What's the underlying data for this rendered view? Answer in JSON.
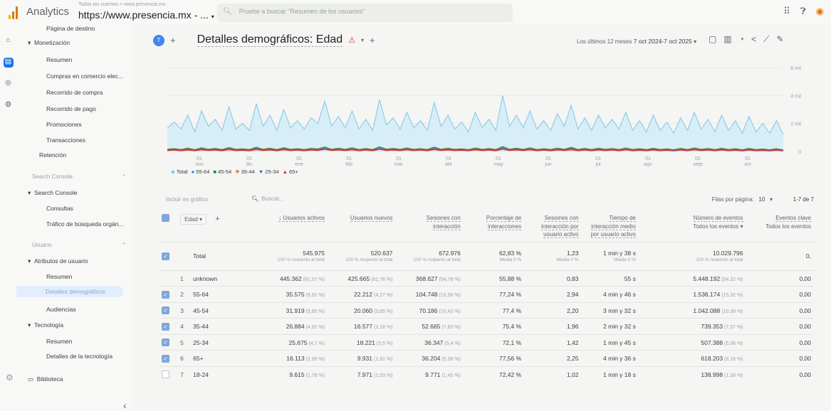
{
  "topbar": {
    "app_name": "Analytics",
    "account_path": "Todas las cuentas > www.presencia.mx",
    "property": "https://www.presencia.mx - ...",
    "search_placeholder": "Pruebe a buscar \"Resumen de los usuarios\""
  },
  "nav": {
    "items": [
      {
        "label": "Página de destino"
      },
      {
        "label": "Monetización"
      },
      {
        "label": "Resumen"
      },
      {
        "label": "Compras en comercio elec..."
      },
      {
        "label": "Recorrido de compra"
      },
      {
        "label": "Recorrido de pago"
      },
      {
        "label": "Promociones"
      },
      {
        "label": "Transacciones"
      },
      {
        "label": "Retención"
      },
      {
        "label": "Search Console"
      },
      {
        "label": "Search Console"
      },
      {
        "label": "Consultas"
      },
      {
        "label": "Tráfico de búsqueda orgán..."
      },
      {
        "label": "Usuario"
      },
      {
        "label": "Atributos de usuario"
      },
      {
        "label": "Resumen"
      },
      {
        "label": "Detalles demográficos"
      },
      {
        "label": "Audiencias"
      },
      {
        "label": "Tecnología"
      },
      {
        "label": "Resumen"
      },
      {
        "label": "Detalles de la tecnología"
      },
      {
        "label": "Biblioteca"
      }
    ]
  },
  "header": {
    "avatar": "T",
    "title": "Detalles demográficos: Edad",
    "date_prefix": "Los últimos 12 meses",
    "date_range": "7 oct 2024-7 oct 2025"
  },
  "chart_data": {
    "type": "line",
    "x_ticks": [
      {
        "day": "01",
        "month": "nov"
      },
      {
        "day": "01",
        "month": "dic"
      },
      {
        "day": "01",
        "month": "ene"
      },
      {
        "day": "01",
        "month": "feb"
      },
      {
        "day": "01",
        "month": "mar"
      },
      {
        "day": "01",
        "month": "abr"
      },
      {
        "day": "01",
        "month": "may"
      },
      {
        "day": "01",
        "month": "jun"
      },
      {
        "day": "01",
        "month": "jul"
      },
      {
        "day": "01",
        "month": "ago"
      },
      {
        "day": "01",
        "month": "sept"
      },
      {
        "day": "01",
        "month": "oct"
      }
    ],
    "y_ticks": [
      "6 mil",
      "4 mil",
      "2 mil",
      "0"
    ],
    "ylim": [
      0,
      6000
    ],
    "series": [
      {
        "name": "Total",
        "color": "#7ec8e3",
        "values": [
          1700,
          2100,
          1600,
          2600,
          1400,
          2900,
          1800,
          2300,
          1500,
          3200,
          1600,
          2000,
          1500,
          3400,
          1800,
          2600,
          1500,
          3000,
          1700,
          2200,
          1600,
          2400,
          2000,
          3600,
          1800,
          2500,
          1700,
          2900,
          1600,
          2300,
          1500,
          3700,
          1900,
          2400,
          1600,
          2800,
          1700,
          2200,
          1500,
          3500,
          1800,
          2600,
          1600,
          2100,
          1400,
          2800,
          1700,
          2300,
          1500,
          4000,
          1800,
          2600,
          1700,
          2900,
          1600,
          2200,
          1500,
          2700,
          1800,
          3300,
          1600,
          2400,
          1500,
          2600,
          1700,
          2300,
          1600,
          2800,
          1500,
          2200,
          1400,
          2600,
          1500,
          2100,
          1300,
          2400,
          1500,
          2800,
          1600,
          2300,
          1400,
          2600,
          1500,
          2200,
          1300,
          2500,
          1400,
          2000,
          1300,
          2200,
          1200
        ]
      },
      {
        "name": "55-64",
        "color": "#1a73e8",
        "values": [
          120,
          160,
          110,
          190,
          100,
          200,
          130,
          170,
          110,
          220,
          120,
          150,
          110,
          230,
          130,
          180,
          110,
          210,
          120,
          160,
          110,
          170,
          140,
          240,
          130,
          180,
          120,
          200,
          110,
          160,
          110,
          250,
          140,
          170,
          110,
          190,
          120,
          160,
          110,
          230,
          130,
          180,
          110,
          150,
          100,
          190,
          120,
          160,
          110,
          260,
          130,
          180,
          120,
          200,
          110,
          160,
          110,
          190,
          130,
          220,
          110,
          170,
          110,
          180,
          120,
          160,
          110,
          190,
          110,
          150,
          100,
          180,
          110,
          150,
          90,
          170,
          110,
          190,
          110,
          160,
          100,
          180,
          110,
          150,
          90,
          170,
          100,
          140,
          90,
          150,
          80
        ]
      },
      {
        "name": "45-54",
        "color": "#188038",
        "values": [
          160,
          200,
          140,
          240,
          130,
          260,
          160,
          210,
          140,
          280,
          150,
          190,
          140,
          300,
          160,
          230,
          140,
          270,
          150,
          200,
          140,
          220,
          180,
          320,
          160,
          230,
          150,
          260,
          140,
          210,
          140,
          330,
          170,
          220,
          150,
          250,
          150,
          200,
          140,
          310,
          160,
          230,
          150,
          190,
          130,
          250,
          150,
          210,
          140,
          350,
          160,
          230,
          150,
          260,
          140,
          200,
          140,
          240,
          160,
          290,
          140,
          220,
          140,
          230,
          150,
          210,
          140,
          250,
          140,
          200,
          130,
          230,
          140,
          190,
          120,
          220,
          140,
          250,
          150,
          210,
          130,
          230,
          140,
          200,
          120,
          220,
          130,
          180,
          120,
          200,
          110
        ]
      },
      {
        "name": "35-44",
        "color": "#e8710a",
        "values": [
          130,
          170,
          120,
          210,
          110,
          230,
          140,
          180,
          120,
          250,
          130,
          160,
          120,
          260,
          140,
          200,
          120,
          240,
          130,
          170,
          120,
          190,
          150,
          280,
          140,
          200,
          130,
          230,
          120,
          180,
          120,
          290,
          150,
          190,
          130,
          220,
          130,
          170,
          120,
          270,
          140,
          200,
          130,
          160,
          110,
          220,
          130,
          180,
          120,
          310,
          140,
          200,
          130,
          230,
          120,
          170,
          120,
          210,
          140,
          250,
          120,
          190,
          120,
          200,
          130,
          180,
          120,
          220,
          120,
          170,
          110,
          200,
          120,
          160,
          100,
          190,
          120,
          220,
          130,
          180,
          110,
          200,
          120,
          170,
          100,
          190,
          110,
          150,
          100,
          170,
          90
        ]
      },
      {
        "name": "25-34",
        "color": "#1967d2",
        "values": [
          100,
          140,
          90,
          160,
          80,
          180,
          110,
          150,
          90,
          200,
          100,
          130,
          90,
          210,
          110,
          160,
          90,
          190,
          100,
          140,
          90,
          150,
          120,
          220,
          110,
          160,
          100,
          180,
          90,
          140,
          90,
          230,
          120,
          150,
          100,
          170,
          100,
          140,
          90,
          210,
          110,
          160,
          100,
          130,
          80,
          170,
          100,
          140,
          90,
          240,
          110,
          160,
          100,
          180,
          90,
          140,
          90,
          170,
          110,
          200,
          90,
          150,
          90,
          160,
          100,
          140,
          90,
          170,
          90,
          130,
          80,
          160,
          90,
          130,
          80,
          150,
          90,
          170,
          100,
          140,
          80,
          160,
          90,
          130,
          70,
          150,
          80,
          120,
          70,
          130,
          60
        ]
      },
      {
        "name": "65+",
        "color": "#d93025",
        "values": [
          60,
          90,
          50,
          100,
          50,
          110,
          70,
          90,
          50,
          120,
          60,
          80,
          50,
          130,
          70,
          100,
          50,
          120,
          60,
          90,
          50,
          90,
          70,
          140,
          70,
          100,
          60,
          110,
          50,
          90,
          50,
          140,
          70,
          90,
          60,
          110,
          60,
          90,
          50,
          130,
          70,
          100,
          60,
          80,
          50,
          110,
          60,
          90,
          50,
          150,
          70,
          100,
          60,
          110,
          50,
          90,
          50,
          100,
          70,
          120,
          50,
          90,
          50,
          100,
          60,
          90,
          50,
          110,
          50,
          80,
          50,
          100,
          50,
          80,
          40,
          90,
          50,
          110,
          60,
          90,
          50,
          100,
          50,
          80,
          40,
          90,
          50,
          70,
          40,
          80,
          40
        ]
      }
    ]
  },
  "legend": [
    {
      "name": "Total",
      "color": "#7ec8e3",
      "glyph": "◆"
    },
    {
      "name": "55-64",
      "color": "#1a73e8",
      "glyph": "●"
    },
    {
      "name": "45-54",
      "color": "#188038",
      "glyph": "■"
    },
    {
      "name": "35-44",
      "color": "#e8710a",
      "glyph": "✚"
    },
    {
      "name": "25-34",
      "color": "#1967d2",
      "glyph": "▼"
    },
    {
      "name": "65+",
      "color": "#d93025",
      "glyph": "▲"
    }
  ],
  "table_bar": {
    "plot_label": "Incluir en gráfico",
    "search_label": "Buscar...",
    "rows_per_page_label": "Filas por página:",
    "rows_per_page": "10",
    "pagination": "1-7 de 7"
  },
  "table": {
    "dim_header": "Edad",
    "headers": [
      "↓ Usuarios activos",
      "Usuarios nuevos",
      "Sesiones con interacción",
      "Porcentaje de interacciones",
      "Sesiones con interacción por usuario activo",
      "Tiempo de interacción medio por usuario activo",
      "Número de eventos",
      "Eventos clave"
    ],
    "header_sub": [
      "",
      "",
      "",
      "",
      "",
      "",
      "Todos los eventos ▾",
      "Todos los eventos"
    ],
    "total": {
      "label": "Total",
      "cells": [
        [
          "545.975",
          "100 % respecto al total"
        ],
        [
          "520.637",
          "100 % respecto al total"
        ],
        [
          "672.976",
          "100 % respecto al total"
        ],
        [
          "62,83 %",
          "Media 0 %"
        ],
        [
          "1,23",
          "Media 0 %"
        ],
        [
          "1 min y 38 s",
          "Media 0 %"
        ],
        [
          "10.029.796",
          "100 % respecto al total"
        ],
        [
          "0,",
          ""
        ]
      ]
    },
    "rows": [
      {
        "n": "1",
        "dim": "unknown",
        "checked": "none",
        "cells": [
          [
            "445.362",
            "(81,57 %)"
          ],
          [
            "425.665",
            "(81,76 %)"
          ],
          [
            "368.627",
            "(54,78 %)"
          ],
          [
            "55,88 %",
            ""
          ],
          [
            "0,83",
            ""
          ],
          [
            "55 s",
            ""
          ],
          [
            "5.448.192",
            "(54,32 %)"
          ],
          [
            "0,00",
            ""
          ]
        ]
      },
      {
        "n": "2",
        "dim": "55-64",
        "checked": "on",
        "cells": [
          [
            "35.575",
            "(6,52 %)"
          ],
          [
            "22.212",
            "(4,27 %)"
          ],
          [
            "104.748",
            "(15,56 %)"
          ],
          [
            "77,24 %",
            ""
          ],
          [
            "2,94",
            ""
          ],
          [
            "4 min y 46 s",
            ""
          ],
          [
            "1.536.174",
            "(15,32 %)"
          ],
          [
            "0,00",
            ""
          ]
        ]
      },
      {
        "n": "3",
        "dim": "45-54",
        "checked": "on",
        "cells": [
          [
            "31.919",
            "(5,85 %)"
          ],
          [
            "20.060",
            "(3,85 %)"
          ],
          [
            "70.186",
            "(10,43 %)"
          ],
          [
            "77,4 %",
            ""
          ],
          [
            "2,20",
            ""
          ],
          [
            "3 min y 32 s",
            ""
          ],
          [
            "1.042.088",
            "(10,39 %)"
          ],
          [
            "0,00",
            ""
          ]
        ]
      },
      {
        "n": "4",
        "dim": "35-44",
        "checked": "on",
        "cells": [
          [
            "26.884",
            "(4,92 %)"
          ],
          [
            "16.577",
            "(3,18 %)"
          ],
          [
            "52.665",
            "(7,83 %)"
          ],
          [
            "75,4 %",
            ""
          ],
          [
            "1,96",
            ""
          ],
          [
            "2 min y 32 s",
            ""
          ],
          [
            "739.353",
            "(7,37 %)"
          ],
          [
            "0,00",
            ""
          ]
        ]
      },
      {
        "n": "5",
        "dim": "25-34",
        "checked": "on",
        "cells": [
          [
            "25.675",
            "(4,7 %)"
          ],
          [
            "18.221",
            "(3,5 %)"
          ],
          [
            "36.347",
            "(5,4 %)"
          ],
          [
            "72,1 %",
            ""
          ],
          [
            "1,42",
            ""
          ],
          [
            "1 min y 45 s",
            ""
          ],
          [
            "507.388",
            "(5,06 %)"
          ],
          [
            "0,00",
            ""
          ]
        ]
      },
      {
        "n": "6",
        "dim": "65+",
        "checked": "on",
        "cells": [
          [
            "16.113",
            "(2,95 %)"
          ],
          [
            "9.931",
            "(1,91 %)"
          ],
          [
            "36.204",
            "(5,38 %)"
          ],
          [
            "77,56 %",
            ""
          ],
          [
            "2,25",
            ""
          ],
          [
            "4 min y 36 s",
            ""
          ],
          [
            "618.203",
            "(6,16 %)"
          ],
          [
            "0,00",
            ""
          ]
        ]
      },
      {
        "n": "7",
        "dim": "18-24",
        "checked": "off",
        "cells": [
          [
            "9.615",
            "(1,76 %)"
          ],
          [
            "7.971",
            "(1,53 %)"
          ],
          [
            "9.771",
            "(1,45 %)"
          ],
          [
            "72,42 %",
            ""
          ],
          [
            "1,02",
            ""
          ],
          [
            "1 min y 18 s",
            ""
          ],
          [
            "138.998",
            "(1,39 %)"
          ],
          [
            "0,00",
            ""
          ]
        ]
      }
    ]
  }
}
